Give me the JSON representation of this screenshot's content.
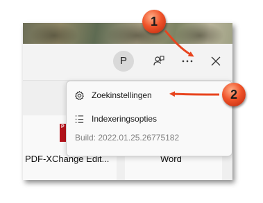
{
  "topbar": {
    "avatar_letter": "P",
    "feedback_icon": "feedback-person-icon",
    "more_icon": "more-dots-icon",
    "close_icon": "close-icon"
  },
  "menu": {
    "items": [
      {
        "label": "Zoekinstellingen",
        "icon": "gear-icon"
      },
      {
        "label": "Indexeringsopties",
        "icon": "list-icon"
      }
    ],
    "build": "Build: 2022.01.25.26775182"
  },
  "apps": [
    {
      "label": "PDF-XChange Edit...",
      "icon": "pdf-app-icon"
    },
    {
      "label": "Word",
      "icon": "word-app-icon"
    }
  ],
  "callouts": {
    "one": "1",
    "two": "2",
    "color": "#e8441e"
  }
}
